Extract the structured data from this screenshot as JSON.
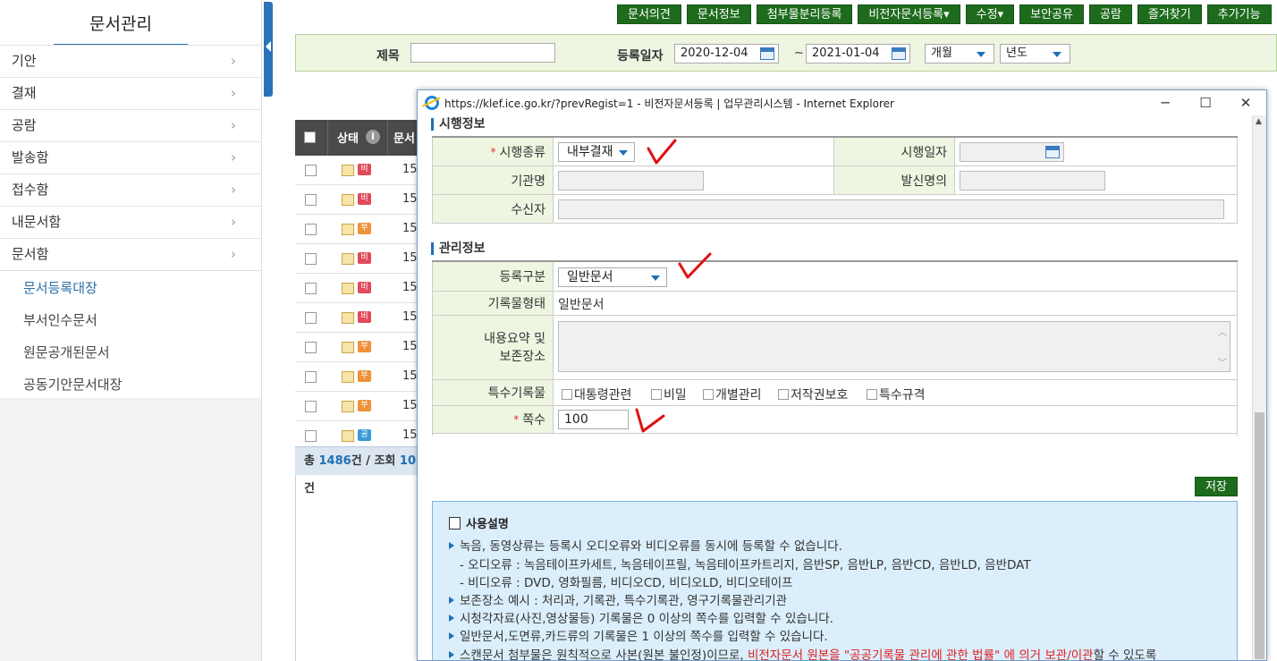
{
  "sidebar": {
    "title": "문서관리",
    "menu": [
      {
        "label": "기안"
      },
      {
        "label": "결재"
      },
      {
        "label": "공람"
      },
      {
        "label": "발송함"
      },
      {
        "label": "접수함"
      },
      {
        "label": "내문서함"
      },
      {
        "label": "문서함"
      }
    ],
    "submenu": [
      {
        "label": "문서등록대장",
        "active": true
      },
      {
        "label": "부서인수문서"
      },
      {
        "label": "원문공개된문서"
      },
      {
        "label": "공동기안문서대장"
      }
    ]
  },
  "toolbar": {
    "buttons": [
      "문서의견",
      "문서정보",
      "첨부물분리등록",
      "비전자문서등록▾",
      "수정▾",
      "보안공유",
      "공람",
      "즐겨찾기",
      "추가기능"
    ]
  },
  "search": {
    "title_label": "제목",
    "title_value": "",
    "date_label": "등록일자",
    "date_from": "2020-12-04",
    "tilde": "~",
    "date_to": "2021-01-04",
    "period_select": "개월",
    "year_select": "년도"
  },
  "list": {
    "header_status": "상태",
    "header_doc": "문서",
    "rows": [
      {
        "badge": "비",
        "type": "b",
        "num": "153"
      },
      {
        "badge": "비",
        "type": "b",
        "num": "153"
      },
      {
        "badge": "부",
        "type": "u",
        "num": "153"
      },
      {
        "badge": "비",
        "type": "b",
        "num": "153"
      },
      {
        "badge": "비",
        "type": "b",
        "num": "153"
      },
      {
        "badge": "비",
        "type": "b",
        "num": "153"
      },
      {
        "badge": "부",
        "type": "u",
        "num": "153"
      },
      {
        "badge": "부",
        "type": "u",
        "num": "153"
      },
      {
        "badge": "부",
        "type": "u",
        "num": "153"
      },
      {
        "badge": "공",
        "type": "g",
        "num": "153"
      }
    ],
    "footer_total_prefix": "총 ",
    "footer_total": "1486",
    "footer_mid": "건 / 조회 ",
    "footer_view": "10",
    "footer_suffix": "건"
  },
  "popup": {
    "title": "https://klef.ice.go.kr/?prevRegist=1 - 비전자문서등록 | 업무관리시스템 - Internet Explorer",
    "minimize": "─",
    "maximize": "☐",
    "close": "✕",
    "section1": "시행정보",
    "exec_type_label": "시행종류",
    "exec_type_value": "내부결재",
    "exec_date_label": "시행일자",
    "org_label": "기관명",
    "sender_label": "발신명의",
    "recipient_label": "수신자",
    "section2": "관리정보",
    "reg_type_label": "등록구분",
    "reg_type_value": "일반문서",
    "record_form_label": "기록물형태",
    "record_form_value": "일반문서",
    "summary_label_1": "내용요약 및",
    "summary_label_2": "보존장소",
    "special_label": "특수기록물",
    "special_options": [
      "대통령관련",
      "비밀",
      "개별관리",
      "저작권보호",
      "특수규격"
    ],
    "pages_label": "쪽수",
    "pages_value": "100",
    "required_mark": "*",
    "save_label": "저장",
    "guide_title": "사용설명",
    "guide_lines": [
      "녹음, 동영상류는 등록시 오디오류와 비디오류를 동시에 등록할 수 없습니다.",
      "- 오디오류 : 녹음테이프카세트, 녹음테이프릴, 녹음테이프카트리지, 음반SP, 음반LP, 음반CD, 음반LD, 음반DAT",
      "- 비디오류 : DVD, 영화필름, 비디오CD, 비디오LD, 비디오테이프",
      "보존장소 예시 : 처리과, 기록관, 특수기록관, 영구기록물관리기관",
      "시청각자료(사진,영상물등) 기록물은 0 이상의 쪽수를 입력할 수 있습니다.",
      "일반문서,도면류,카드류의 기록물은 1 이상의 쪽수를 입력할 수 있습니다."
    ],
    "guide_last_pre": "스캔문서 첨부물은 원칙적으로 사본(원본 불인정)이므로, ",
    "guide_last_red": "비전자문서 원본을 \"공공기록물 관리에 관한 법률\" 에 의거 보관/이관",
    "guide_last_post": "할 수 있도록"
  },
  "colors": {
    "accent_blue": "#1f6fb5",
    "button_green": "#1e6b1e",
    "form_label_bg": "#eef6e2",
    "annotation_red": "#e01010"
  }
}
